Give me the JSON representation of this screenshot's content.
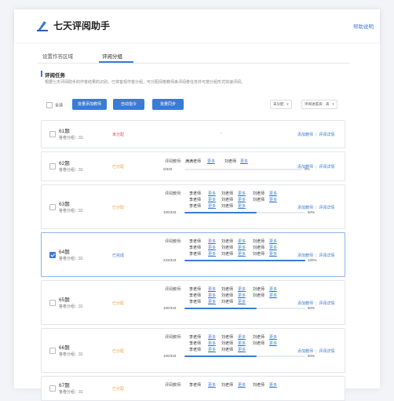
{
  "app": {
    "title": "七天评阅助手",
    "help": "帮助说明"
  },
  "tabs": [
    {
      "label": "设置作答区域"
    },
    {
      "label": "评阅分组"
    }
  ],
  "section": {
    "title": "评阅任务",
    "desc": "根据七天评阅助手的作答结果的识别，已将客观作答分组，可分配阅卷教师来评阅卷任务并可按分组形式快速评阅。"
  },
  "toolbar": {
    "select_all": "全选",
    "btn_batch_add": "批量添加教师",
    "btn_auto_assign": "自动指令",
    "btn_sync": "批量同步",
    "sort_select": "未分配",
    "speed_select": "评阅进度高：高"
  },
  "labels": {
    "reviewer": "评阅教师:",
    "more": "更多",
    "add_teacher": "添加教师",
    "review_detail": "评阅详情"
  },
  "questions": [
    {
      "name": "61题",
      "score": "答卷分组：31",
      "status": "未分配",
      "status_color": "#e14b4b",
      "dash": "-"
    },
    {
      "name": "62题",
      "score": "答卷分组：31",
      "status": "已分配",
      "status_color": "#f2a13a",
      "teachers": [
        "满满老师",
        "刘老师"
      ],
      "count": "0/333",
      "progress_pct": 0,
      "progress_label": "0%"
    },
    {
      "name": "63题",
      "score": "答卷分组：31",
      "status": "已分配",
      "status_color": "#f2a13a",
      "teachers": [
        "李老师",
        "刘老师",
        "刘老师",
        "李老师",
        "刘老师",
        "刘老师",
        "李老师",
        "刘老师"
      ],
      "count": "100/333",
      "progress_pct": 60,
      "progress_label": "60%"
    },
    {
      "name": "64题",
      "score": "答卷分组：31",
      "status": "已完成",
      "status_color": "#3a7bd5",
      "teachers": [
        "李老师",
        "刘老师",
        "刘老师",
        "李老师",
        "刘老师",
        "刘老师",
        "李老师",
        "刘老师",
        "刘老师"
      ],
      "count": "233/333",
      "progress_pct": 100,
      "progress_label": "100%"
    },
    {
      "name": "65题",
      "score": "答卷分组：31",
      "status": "已分配",
      "status_color": "#f2a13a",
      "teachers": [
        "李老师",
        "刘老师",
        "刘老师",
        "李老师",
        "刘老师",
        "刘老师",
        "李老师",
        "刘老师"
      ],
      "count": "100/333",
      "progress_pct": 60,
      "progress_label": "60%"
    },
    {
      "name": "66题",
      "score": "答卷分组：31",
      "status": "已分配",
      "status_color": "#f2a13a",
      "teachers": [
        "李老师",
        "刘老师",
        "刘老师",
        "李老师",
        "刘老师",
        "刘老师",
        "李老师",
        "刘老师"
      ],
      "count": "100/333",
      "progress_pct": 60,
      "progress_label": "60%"
    },
    {
      "name": "67题",
      "score": "答卷分组：31",
      "status": "已分配",
      "status_color": "#f2a13a",
      "teachers": [
        "李老师",
        "刘老师",
        "刘老师"
      ]
    }
  ]
}
